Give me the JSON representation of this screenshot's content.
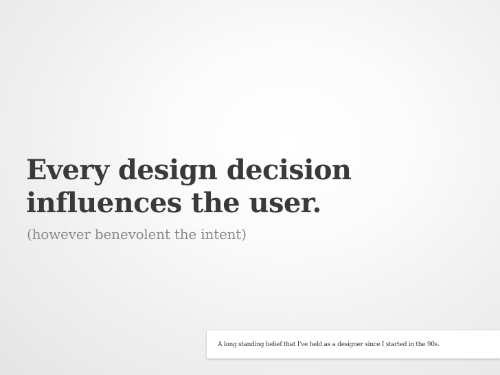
{
  "slide": {
    "headline_line1": "Every design decision",
    "headline_line2": "influences the user.",
    "subtitle": "(however benevolent the intent)",
    "note": "A long standing belief that I've held as a designer since I started in the 90s."
  },
  "colors": {
    "headline": "#3a3a3a",
    "subtitle": "#8a8a8a",
    "note_background": "#ffffff",
    "note_text": "#333333"
  }
}
